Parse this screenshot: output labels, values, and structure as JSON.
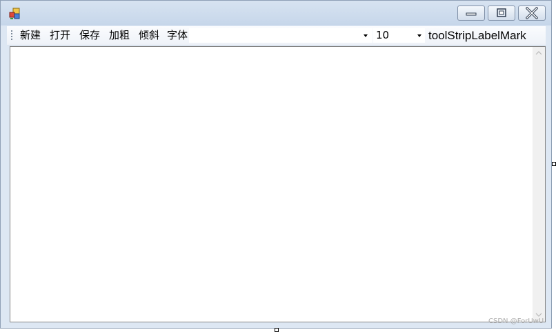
{
  "window": {
    "title": "",
    "app_icon": "form-app-icon",
    "caption_buttons": [
      "minimize-icon",
      "maximize-icon",
      "close-icon"
    ]
  },
  "toolstrip": {
    "buttons": [
      {
        "name": "new-button",
        "label": "新建"
      },
      {
        "name": "open-button",
        "label": "打开"
      },
      {
        "name": "save-button",
        "label": "保存"
      },
      {
        "name": "bold-button",
        "label": "加粗"
      },
      {
        "name": "italic-button",
        "label": "倾斜"
      },
      {
        "name": "font-button",
        "label": "字体"
      }
    ],
    "font_combo_value": "",
    "size_combo_value": "10",
    "label_text": "toolStripLabelMark"
  },
  "editor": {
    "text": ""
  },
  "watermark": "CSDN @ForUwU",
  "colors": {
    "titlebar": "#c6d6ea",
    "window_border": "#8e9fb5",
    "editor_background": "#ffffff"
  }
}
